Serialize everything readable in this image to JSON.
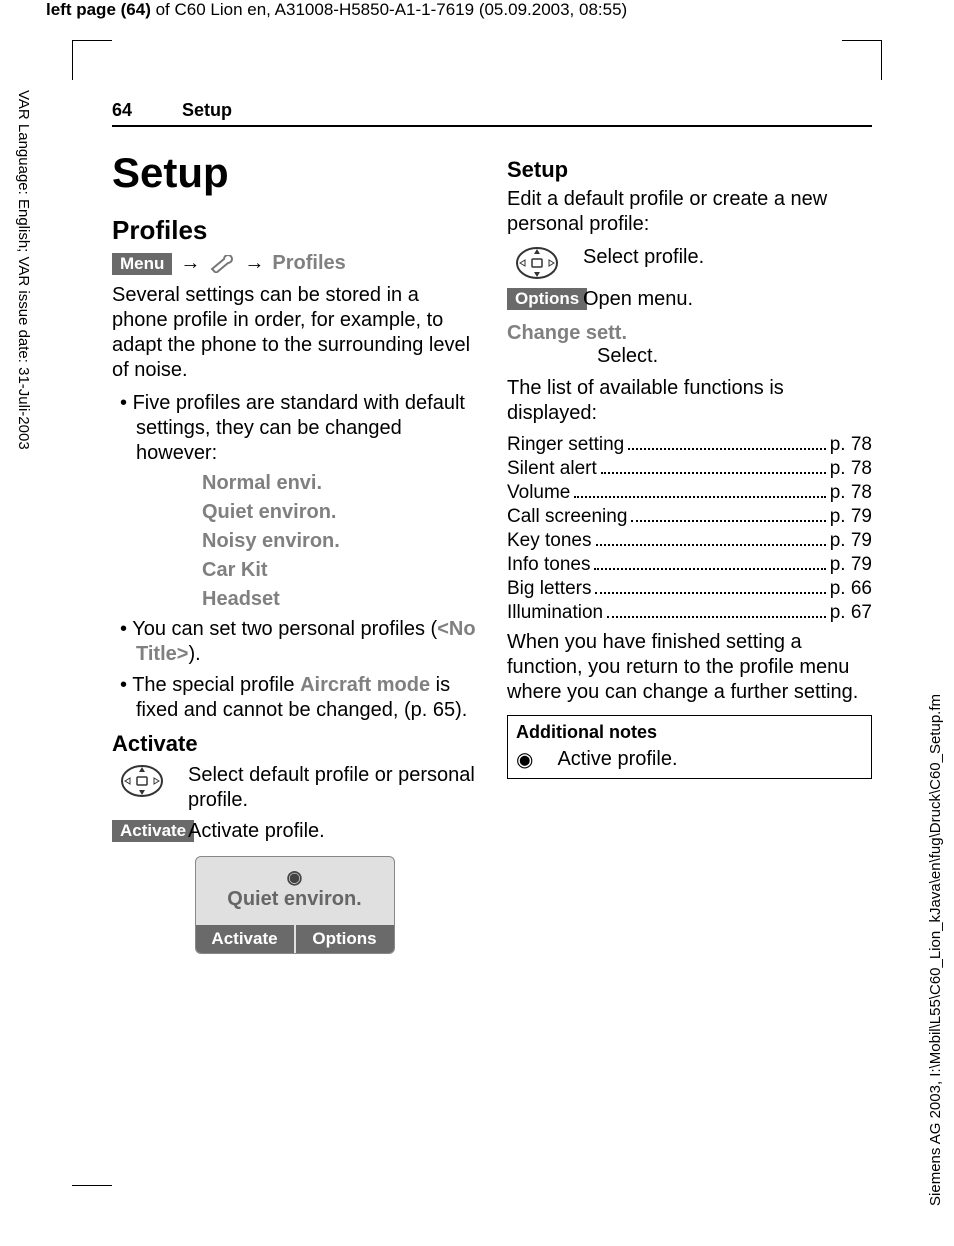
{
  "header_strip": {
    "bold": "left page (64)",
    "rest": " of C60 Lion en, A31008-H5850-A1-1-7619 (05.09.2003, 08:55)"
  },
  "side_left": "VAR Language: English; VAR issue date: 31-Juli-2003",
  "side_right": "Siemens AG 2003, I:\\Mobil\\L55\\C60_Lion_kJava\\en\\fug\\Druck\\C60_Setup.fm",
  "page_header": {
    "num": "64",
    "title": "Setup"
  },
  "left": {
    "h1": "Setup",
    "h2_profiles": "Profiles",
    "nav": {
      "menu": "Menu",
      "profiles": "Profiles"
    },
    "intro": "Several settings can be stored in a phone profile in order, for example, to adapt the phone to the surround­ing level of noise.",
    "bullet1": "Five profiles are standard with default settings, they can be changed however:",
    "profiles": [
      "Normal envi.",
      "Quiet environ.",
      "Noisy environ.",
      "Car Kit",
      "Headset"
    ],
    "bullet2_a": "You can set two personal profiles (",
    "bullet2_b": "<No Title>",
    "bullet2_c": ").",
    "bullet3_a": "The special profile ",
    "bullet3_b": "Aircraft mode",
    "bullet3_c": " is fixed and cannot be changed, (p. 65).",
    "h3_activate": "Activate",
    "row1_text": "Select default profile or personal profile.",
    "row2_chip": "Activate",
    "row2_text": "Activate profile.",
    "phone": {
      "title": "Quiet environ.",
      "sk_left": "Activate",
      "sk_right": "Options"
    }
  },
  "right": {
    "h3_setup": "Setup",
    "intro": "Edit a default profile or create a new personal profile:",
    "row1_text": "Select profile.",
    "row2_chip": "Options",
    "row2_text": "Open menu.",
    "change_label": "Change sett.",
    "change_sub": "Select.",
    "list_intro": "The list of available functions is displayed:",
    "toc": [
      {
        "label": "Ringer setting",
        "page": "p. 78"
      },
      {
        "label": "Silent alert",
        "page": "p. 78"
      },
      {
        "label": "Volume",
        "page": "p. 78"
      },
      {
        "label": "Call screening",
        "page": "p. 79"
      },
      {
        "label": "Key tones",
        "page": "p. 79"
      },
      {
        "label": "Info tones",
        "page": "p. 79"
      },
      {
        "label": "Big letters",
        "page": "p. 66"
      },
      {
        "label": "Illumination",
        "page": "p. 67"
      }
    ],
    "outro": "When you have finished setting a function, you return to the profile menu where you can change a fur­ther setting.",
    "notes_title": "Additional notes",
    "notes_text": "Active profile."
  }
}
